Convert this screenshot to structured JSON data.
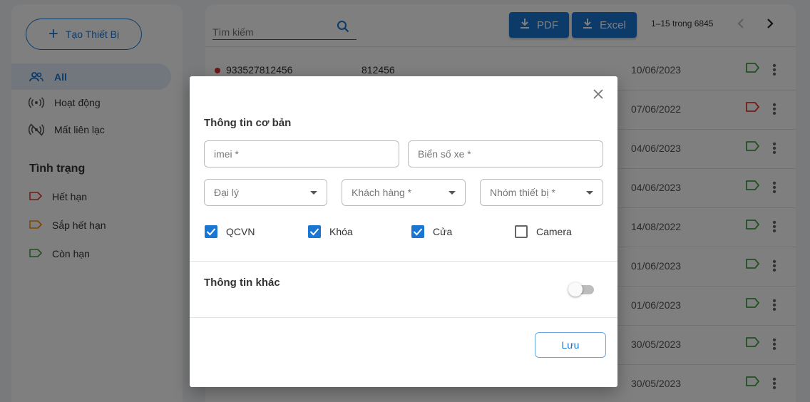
{
  "sidebar": {
    "create_button": "Tạo Thiết Bị",
    "nav": [
      {
        "label": "All",
        "icon": "people-icon",
        "active": true
      },
      {
        "label": "Hoạt động",
        "icon": "signal-icon",
        "active": false
      },
      {
        "label": "Mất liên lạc",
        "icon": "signal-off-icon",
        "active": false
      }
    ],
    "status_title": "Tình trạng",
    "statuses": [
      {
        "label": "Hết hạn",
        "color": "#e53935"
      },
      {
        "label": "Sắp hết hạn",
        "color": "#fb8c00"
      },
      {
        "label": "Còn hạn",
        "color": "#43a047"
      }
    ]
  },
  "toolbar": {
    "search_placeholder": "Tìm kiếm",
    "pdf_label": "PDF",
    "excel_label": "Excel",
    "pagination": "1–15 trong 6845"
  },
  "rows": [
    {
      "imei": "933527812456",
      "plate": "812456",
      "code": "",
      "date": "10/06/2023",
      "tag_color": "#43a047"
    },
    {
      "imei": "",
      "plate": "",
      "code": "",
      "date": "07/06/2022",
      "tag_color": "#e53935"
    },
    {
      "imei": "",
      "plate": "",
      "code": "",
      "date": "04/06/2023",
      "tag_color": "#43a047"
    },
    {
      "imei": "",
      "plate": "",
      "code": "",
      "date": "04/06/2023",
      "tag_color": "#43a047"
    },
    {
      "imei": "",
      "plate": "",
      "code": "",
      "date": "14/08/2022",
      "tag_color": "#43a047"
    },
    {
      "imei": "",
      "plate": "",
      "code": "",
      "date": "01/06/2023",
      "tag_color": "#43a047"
    },
    {
      "imei": "",
      "plate": "",
      "code": "",
      "date": "01/06/2023",
      "tag_color": "#43a047"
    },
    {
      "imei": "",
      "plate": "",
      "code": "",
      "date": "30/05/2023",
      "tag_color": "#43a047"
    },
    {
      "imei": "",
      "plate": "",
      "code": "",
      "date": "30/05/2023",
      "tag_color": "#43a047"
    }
  ],
  "dialog": {
    "basic_title": "Thông tin cơ bản",
    "imei_placeholder": "imei *",
    "plate_placeholder": "Biển số xe *",
    "agent_placeholder": "Đại lý",
    "customer_placeholder": "Khách hàng *",
    "group_placeholder": "Nhóm thiết bị *",
    "checkboxes": [
      {
        "label": "QCVN",
        "checked": true
      },
      {
        "label": "Khóa",
        "checked": true
      },
      {
        "label": "Cửa",
        "checked": true
      },
      {
        "label": "Camera",
        "checked": false
      }
    ],
    "other_title": "Thông tin khác",
    "other_toggle_on": false,
    "save_label": "Lưu"
  },
  "colors": {
    "accent": "#1976d2"
  }
}
